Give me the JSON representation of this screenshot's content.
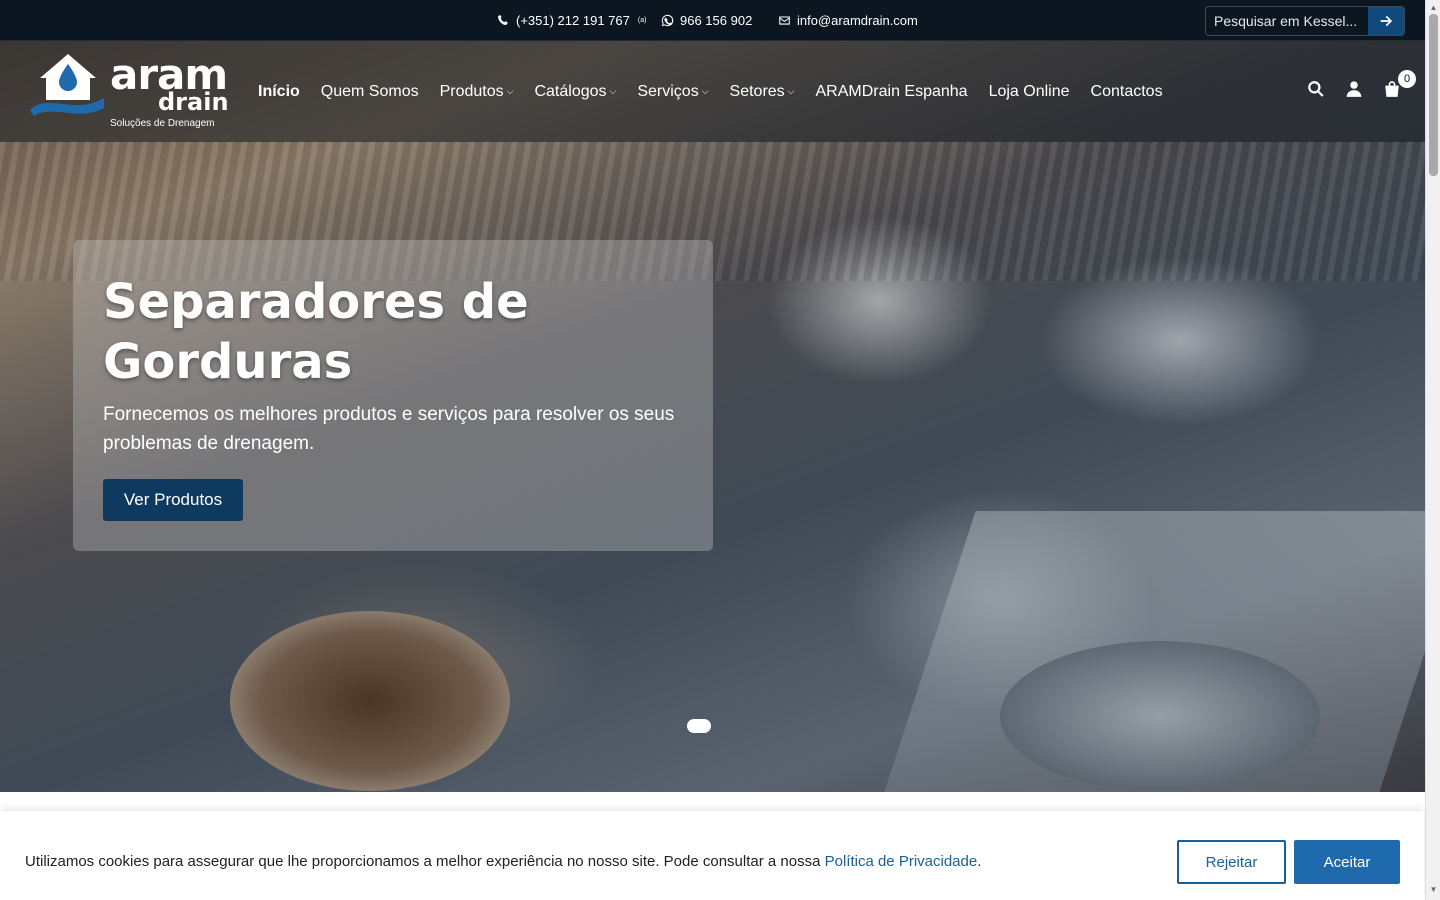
{
  "topbar": {
    "phone": "(+351) 212 191 767",
    "phone_note": "(a)",
    "whatsapp": "966 156 902",
    "email": "info@aramdrain.com",
    "search_placeholder": "Pesquisar em Kessel..."
  },
  "logo": {
    "line1": "aram",
    "line2": "drain",
    "tagline": "Soluções de Drenagem"
  },
  "nav": {
    "items": [
      {
        "label": "Início",
        "active": true
      },
      {
        "label": "Quem Somos"
      },
      {
        "label": "Produtos",
        "dropdown": true
      },
      {
        "label": "Catálogos",
        "dropdown": true
      },
      {
        "label": "Serviços",
        "dropdown": true
      },
      {
        "label": "Setores",
        "dropdown": true
      },
      {
        "label": "ARAMDrain Espanha"
      },
      {
        "label": "Loja Online"
      },
      {
        "label": "Contactos"
      }
    ],
    "cart_count": "0"
  },
  "hero": {
    "title": "Separadores de Gorduras",
    "subtitle": "Fornecemos os melhores produtos e serviços para resolver os seus problemas de drenagem.",
    "button": "Ver Produtos"
  },
  "cookie": {
    "text": "Utilizamos cookies para assegurar que lhe proporcionamos a melhor experiência no nosso site. Pode consultar a nossa",
    "link": "Política de Privacidade",
    "link_suffix": ".",
    "reject": "Rejeitar",
    "accept": "Aceitar"
  },
  "colors": {
    "topbar": "#0b1620",
    "accent": "#1f6aad",
    "button_dark": "#0f3a60"
  }
}
